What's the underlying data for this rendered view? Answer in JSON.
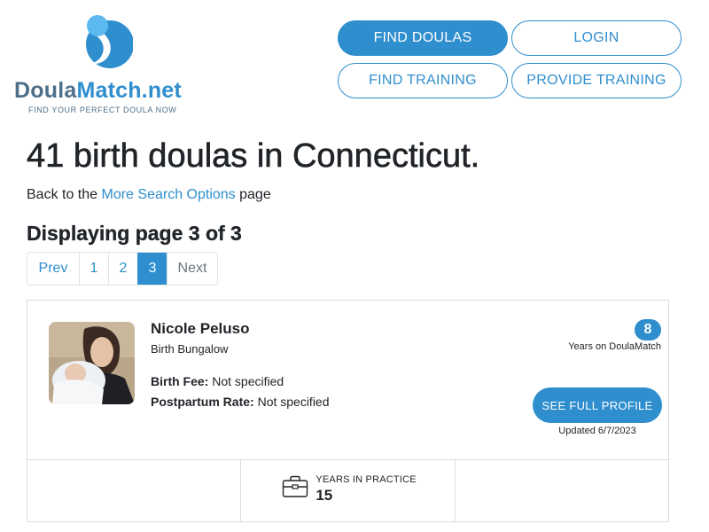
{
  "header": {
    "logo": {
      "name_part1": "Doula",
      "name_part2": "Match.net",
      "tagline": "FIND YOUR PERFECT DOULA NOW"
    },
    "nav": {
      "find_doulas": "FIND DOULAS",
      "login": "LOGIN",
      "find_training": "FIND TRAINING",
      "provide_training": "PROVIDE TRAINING"
    }
  },
  "main": {
    "title": "41 birth doulas in Connecticut.",
    "back": {
      "prefix": "Back to the ",
      "link": "More Search Options",
      "suffix": " page"
    },
    "displaying": "Displaying page 3 of 3",
    "pagination": {
      "prev": "Prev",
      "pages": [
        "1",
        "2",
        "3"
      ],
      "active_page": "3",
      "next": "Next"
    }
  },
  "listing": {
    "name": "Nicole Peluso",
    "organization": "Birth Bungalow",
    "birth_fee_label": "Birth Fee:",
    "birth_fee_value": " Not specified",
    "postpartum_label": "Postpartum Rate:",
    "postpartum_value": " Not specified",
    "years_on_site": "8",
    "years_on_site_label": "Years on DoulaMatch",
    "profile_button": "SEE FULL PROFILE",
    "updated": "Updated 6/7/2023",
    "years_in_practice_label": "YEARS IN PRACTICE",
    "years_in_practice_value": "15"
  },
  "colors": {
    "accent": "#2f8ece",
    "logo_dark": "#4d6f89",
    "logo_light": "#5bb9f0"
  },
  "icons": [
    "doulamatch-logo-icon",
    "briefcase-icon"
  ]
}
